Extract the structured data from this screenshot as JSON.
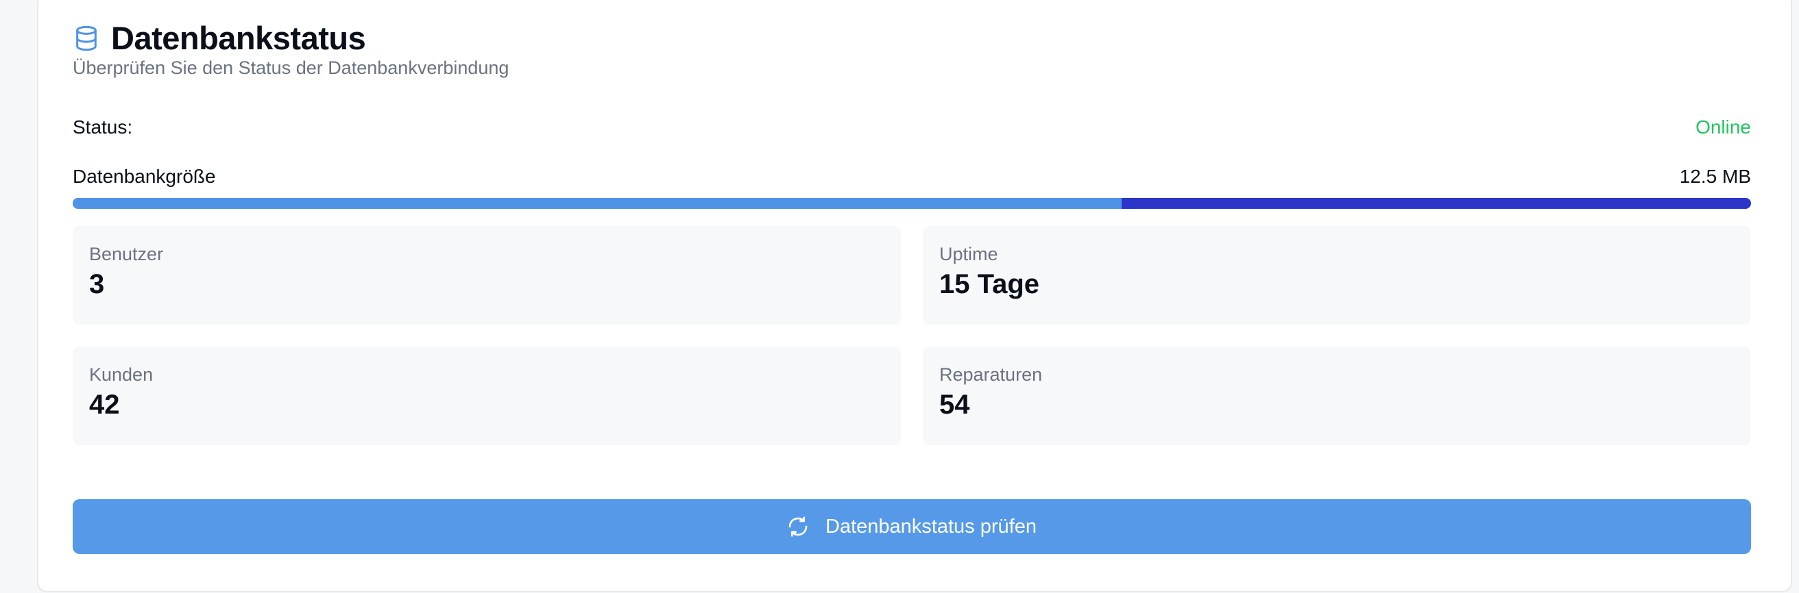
{
  "card": {
    "title": "Datenbankstatus",
    "subtitle": "Überprüfen Sie den Status der Datenbankverbindung",
    "icon": "database-icon"
  },
  "status": {
    "label": "Status:",
    "value": "Online",
    "color": "#22c55e"
  },
  "db_size": {
    "label": "Datenbankgröße",
    "value": "12.5 MB",
    "progress_fraction": 0.625
  },
  "stats": [
    {
      "label": "Benutzer",
      "value": "3"
    },
    {
      "label": "Uptime",
      "value": "15 Tage"
    },
    {
      "label": "Kunden",
      "value": "42"
    },
    {
      "label": "Reparaturen",
      "value": "54"
    }
  ],
  "action": {
    "label": "Datenbankstatus prüfen",
    "icon": "refresh-icon",
    "color": "#5599e8"
  },
  "colors": {
    "accent": "#4f93e6",
    "progress_track": "#2b35c7"
  }
}
